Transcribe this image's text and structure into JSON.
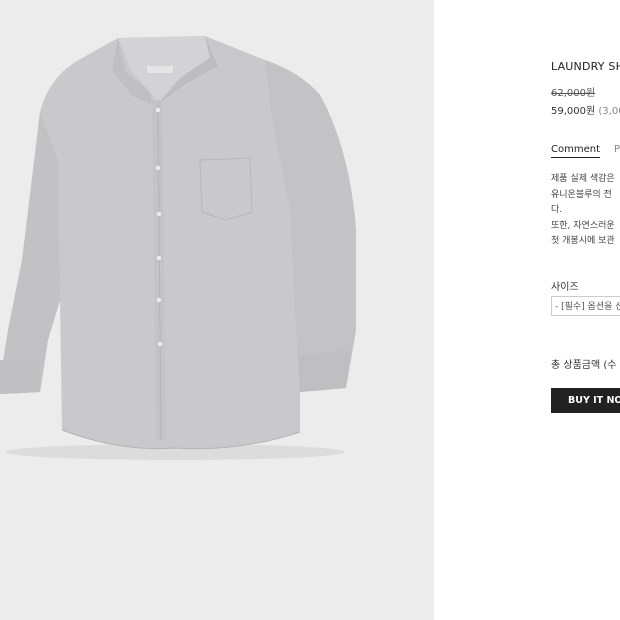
{
  "product": {
    "title": "LAUNDRY SH",
    "original_price": "62,000원",
    "sale_price": "59,000원",
    "point_note": "(3,00"
  },
  "tabs": [
    {
      "label": "Comment",
      "active": true
    },
    {
      "label": "P",
      "active": false
    }
  ],
  "description": [
    "제품 실제 색감은",
    "유니온블루의 전",
    "다.",
    "또한, 자연스러운",
    "첫 개봉시에 보관"
  ],
  "options": {
    "size_label": "사이즈",
    "size_select_value": "- [필수] 옵션을 선"
  },
  "total_label": "총 상품금액 (수",
  "buy_button_label": "BUY IT NOW",
  "colors": {
    "image_background": "#ececec",
    "shirt": "#c9c9cb",
    "button": "#222222"
  }
}
